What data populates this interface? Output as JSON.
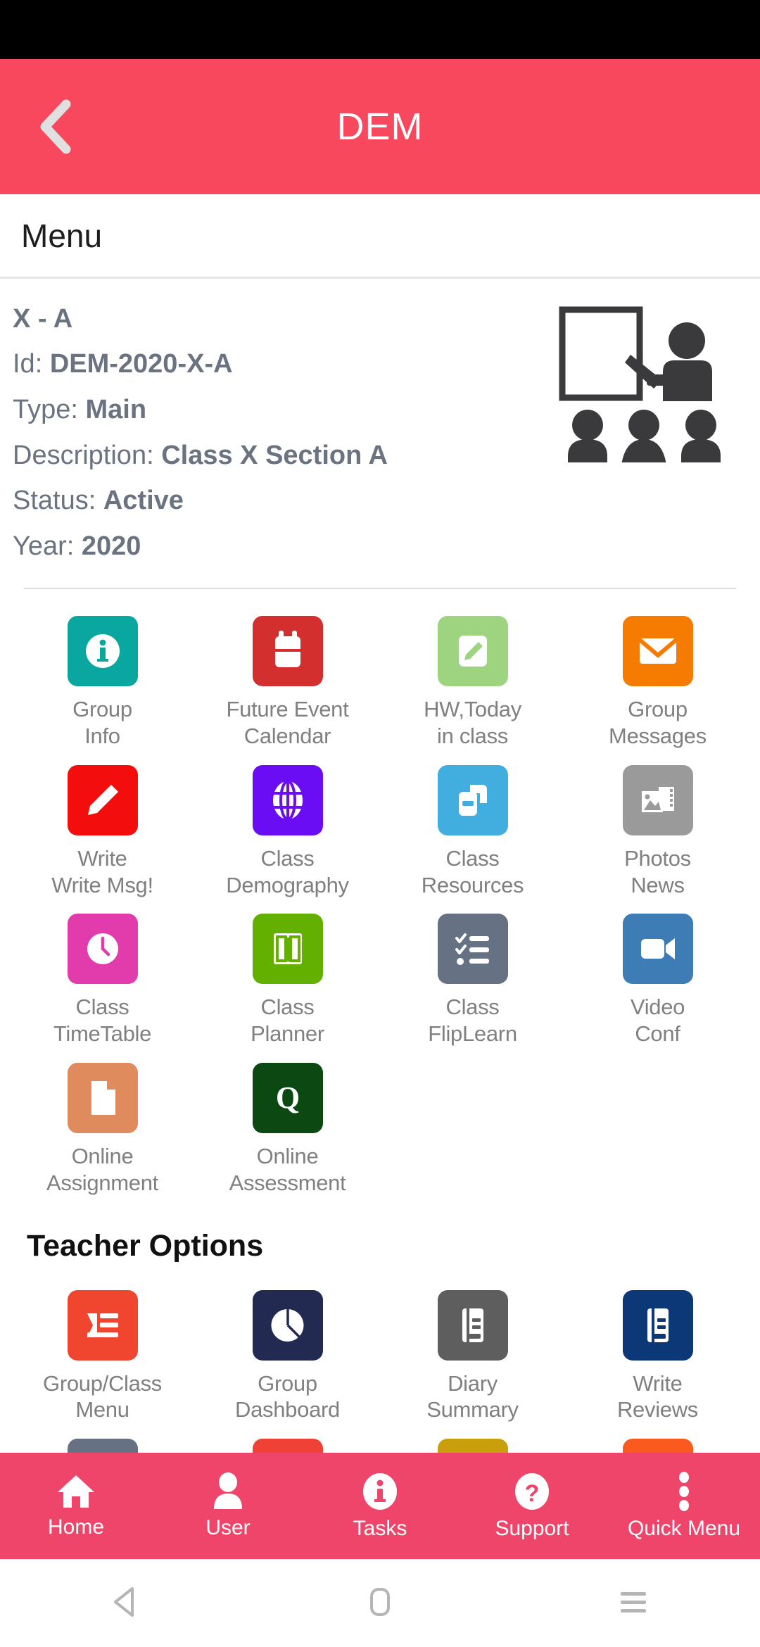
{
  "colors": {
    "header_red": "#f8485e",
    "bottom_nav_red": "#f0456a",
    "label_gray": "#808080",
    "info_gray": "#6b7280"
  },
  "statusbar": {
    "name": "status-bar"
  },
  "appbar": {
    "title": "DEM",
    "back_icon": "chevron-left-icon"
  },
  "menustrip": {
    "label": "Menu"
  },
  "info": {
    "title": "X - A",
    "illustration": "classroom-teacher-illustration",
    "rows": [
      {
        "label": "Id:",
        "value": "DEM-2020-X-A"
      },
      {
        "label": "Type:",
        "value": "Main"
      },
      {
        "label": "Description:",
        "value": "Class X Section A"
      },
      {
        "label": "Status:",
        "value": "Active"
      },
      {
        "label": "Year:",
        "value": "2020"
      }
    ]
  },
  "main_grid": [
    {
      "icon": "info-circle-icon",
      "bg": "#0aa6a0",
      "line1": "Group",
      "line2": "Info"
    },
    {
      "icon": "calendar-icon",
      "bg": "#d32f2f",
      "line1": "Future Event",
      "line2": "Calendar"
    },
    {
      "icon": "pencil-note-icon",
      "bg": "#9ed47f",
      "line1": "HW,Today",
      "line2": "in class"
    },
    {
      "icon": "envelope-icon",
      "bg": "#f57c00",
      "line1": "Group",
      "line2": "Messages"
    },
    {
      "icon": "pencil-icon",
      "bg": "#f40d0d",
      "line1": "Write",
      "line2": "Write Msg!"
    },
    {
      "icon": "globe-icon",
      "bg": "#6a0df5",
      "line1": "Class",
      "line2": "Demography"
    },
    {
      "icon": "copy-stack-icon",
      "bg": "#42addf",
      "line1": "Class",
      "line2": "Resources"
    },
    {
      "icon": "photos-icon",
      "bg": "#9a9a9a",
      "line1": "Photos",
      "line2": "News"
    },
    {
      "icon": "clock-icon",
      "bg": "#e23bab",
      "line1": "Class",
      "line2": "TimeTable"
    },
    {
      "icon": "columns-icon",
      "bg": "#63b000",
      "line1": "Class",
      "line2": "Planner"
    },
    {
      "icon": "checklist-icon",
      "bg": "#667283",
      "line1": "Class",
      "line2": "FlipLearn"
    },
    {
      "icon": "video-camera-icon",
      "bg": "#3d7cb5",
      "line1": "Video",
      "line2": "Conf"
    },
    {
      "icon": "document-icon",
      "bg": "#e08b5e",
      "line1": "Online",
      "line2": "Assignment"
    },
    {
      "icon": "letter-q-icon",
      "bg": "#0b4812",
      "line1": "Online",
      "line2": "Assessment"
    }
  ],
  "teacher_section": {
    "title": "Teacher Options",
    "items": [
      {
        "icon": "indent-list-icon",
        "bg": "#f0452f",
        "line1": "Group/Class",
        "line2": "Menu"
      },
      {
        "icon": "pie-chart-icon",
        "bg": "#222a52",
        "line1": "Group",
        "line2": "Dashboard"
      },
      {
        "icon": "book-gray-icon",
        "bg": "#5e5e5e",
        "line1": "Diary",
        "line2": "Summary"
      },
      {
        "icon": "book-navy-icon",
        "bg": "#0d3878",
        "line1": "Write",
        "line2": "Reviews"
      }
    ],
    "partial_items": [
      {
        "icon": "checklist-icon",
        "bg": "#667283"
      },
      {
        "icon": "check-box-icon",
        "bg": "#ef4136"
      },
      {
        "icon": "stethoscope-icon",
        "bg": "#c9a00c"
      },
      {
        "icon": "gift-icon",
        "bg": "#fa5a1e"
      }
    ]
  },
  "bottomnav": [
    {
      "icon": "home-icon",
      "label": "Home"
    },
    {
      "icon": "user-icon",
      "label": "User"
    },
    {
      "icon": "info-circle-icon",
      "label": "Tasks"
    },
    {
      "icon": "question-circle-icon",
      "label": "Support"
    },
    {
      "icon": "vertical-dots-icon",
      "label": "Quick Menu"
    }
  ],
  "sysnav": [
    {
      "icon": "android-back-icon"
    },
    {
      "icon": "android-home-icon"
    },
    {
      "icon": "android-recents-icon"
    }
  ]
}
